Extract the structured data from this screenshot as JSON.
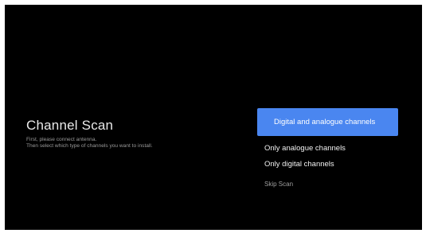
{
  "screen": {
    "title": "Channel Scan",
    "description_line1": "First, please connect antenna.",
    "description_line2": "Then select which type of channels you want to install."
  },
  "options": [
    {
      "label": "Digital and analogue channels",
      "selected": true
    },
    {
      "label": "Only analogue channels",
      "selected": false
    },
    {
      "label": "Only digital channels",
      "selected": false
    },
    {
      "label": "Skip Scan",
      "selected": false
    }
  ],
  "colors": {
    "background": "#000000",
    "accent": "#4a86f0",
    "title_text": "#e9e9e9",
    "secondary_text": "#9a9a9a"
  }
}
